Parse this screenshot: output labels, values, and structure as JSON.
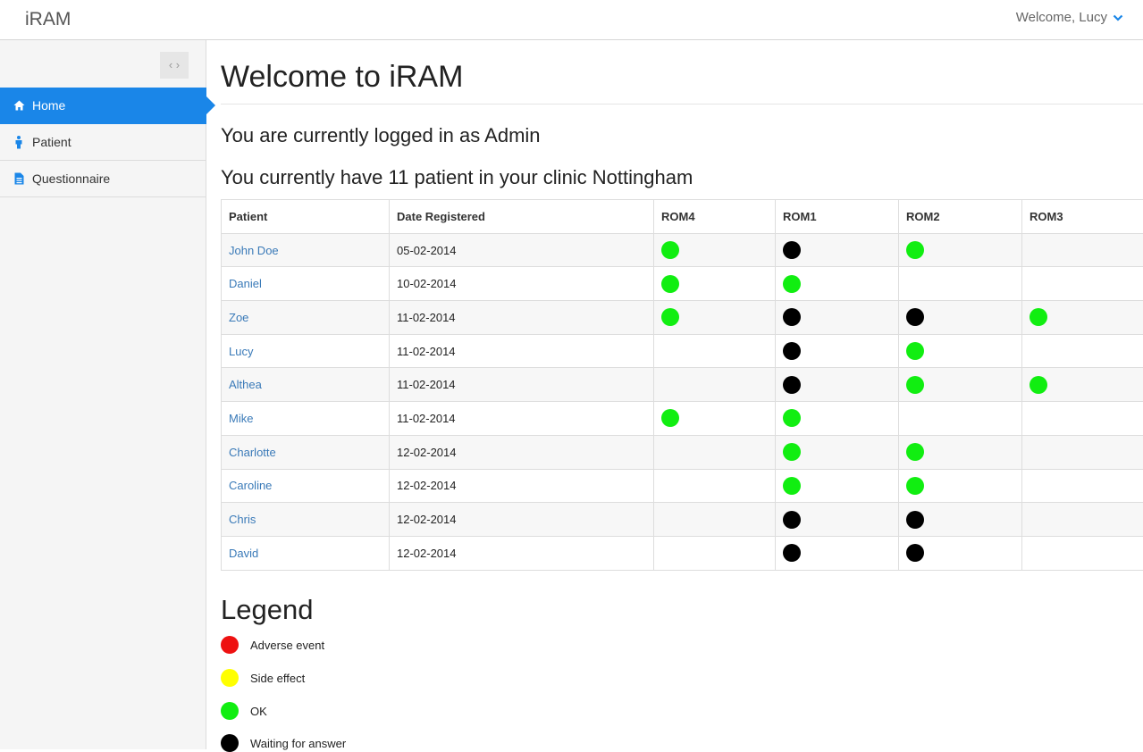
{
  "app": {
    "brand": "iRAM",
    "welcome": "Welcome, Lucy"
  },
  "sidebar": {
    "items": [
      {
        "label": "Home",
        "icon": "home-icon",
        "active": true
      },
      {
        "label": "Patient",
        "icon": "person-icon",
        "active": false
      },
      {
        "label": "Questionnaire",
        "icon": "document-icon",
        "active": false
      }
    ]
  },
  "main": {
    "title": "Welcome to iRAM",
    "logged_in": "You are currently logged in as Admin",
    "patient_count": "You currently have 11 patient in your clinic Nottingham"
  },
  "table": {
    "columns": [
      "Patient",
      "Date Registered",
      "ROM4",
      "ROM1",
      "ROM2",
      "ROM3"
    ],
    "rows": [
      {
        "patient": "John Doe",
        "date": "05-02-2014",
        "rom4": "green",
        "rom1": "black",
        "rom2": "green",
        "rom3": ""
      },
      {
        "patient": "Daniel",
        "date": "10-02-2014",
        "rom4": "green",
        "rom1": "green",
        "rom2": "",
        "rom3": ""
      },
      {
        "patient": "Zoe",
        "date": "11-02-2014",
        "rom4": "green",
        "rom1": "black",
        "rom2": "black",
        "rom3": "green"
      },
      {
        "patient": "Lucy",
        "date": "11-02-2014",
        "rom4": "",
        "rom1": "black",
        "rom2": "green",
        "rom3": ""
      },
      {
        "patient": "Althea",
        "date": "11-02-2014",
        "rom4": "",
        "rom1": "black",
        "rom2": "green",
        "rom3": "green"
      },
      {
        "patient": "Mike",
        "date": "11-02-2014",
        "rom4": "green",
        "rom1": "green",
        "rom2": "",
        "rom3": ""
      },
      {
        "patient": "Charlotte",
        "date": "12-02-2014",
        "rom4": "",
        "rom1": "green",
        "rom2": "green",
        "rom3": ""
      },
      {
        "patient": "Caroline",
        "date": "12-02-2014",
        "rom4": "",
        "rom1": "green",
        "rom2": "green",
        "rom3": ""
      },
      {
        "patient": "Chris",
        "date": "12-02-2014",
        "rom4": "",
        "rom1": "black",
        "rom2": "black",
        "rom3": ""
      },
      {
        "patient": "David",
        "date": "12-02-2014",
        "rom4": "",
        "rom1": "black",
        "rom2": "black",
        "rom3": ""
      }
    ]
  },
  "status_colors": {
    "red": "#ee1111",
    "yellow": "#ffff00",
    "green": "#11ee11",
    "black": "#000000"
  },
  "legend": {
    "title": "Legend",
    "items": [
      {
        "label": "Adverse event",
        "color": "red"
      },
      {
        "label": "Side effect",
        "color": "yellow"
      },
      {
        "label": "OK",
        "color": "green"
      },
      {
        "label": "Waiting for answer",
        "color": "black"
      }
    ]
  }
}
